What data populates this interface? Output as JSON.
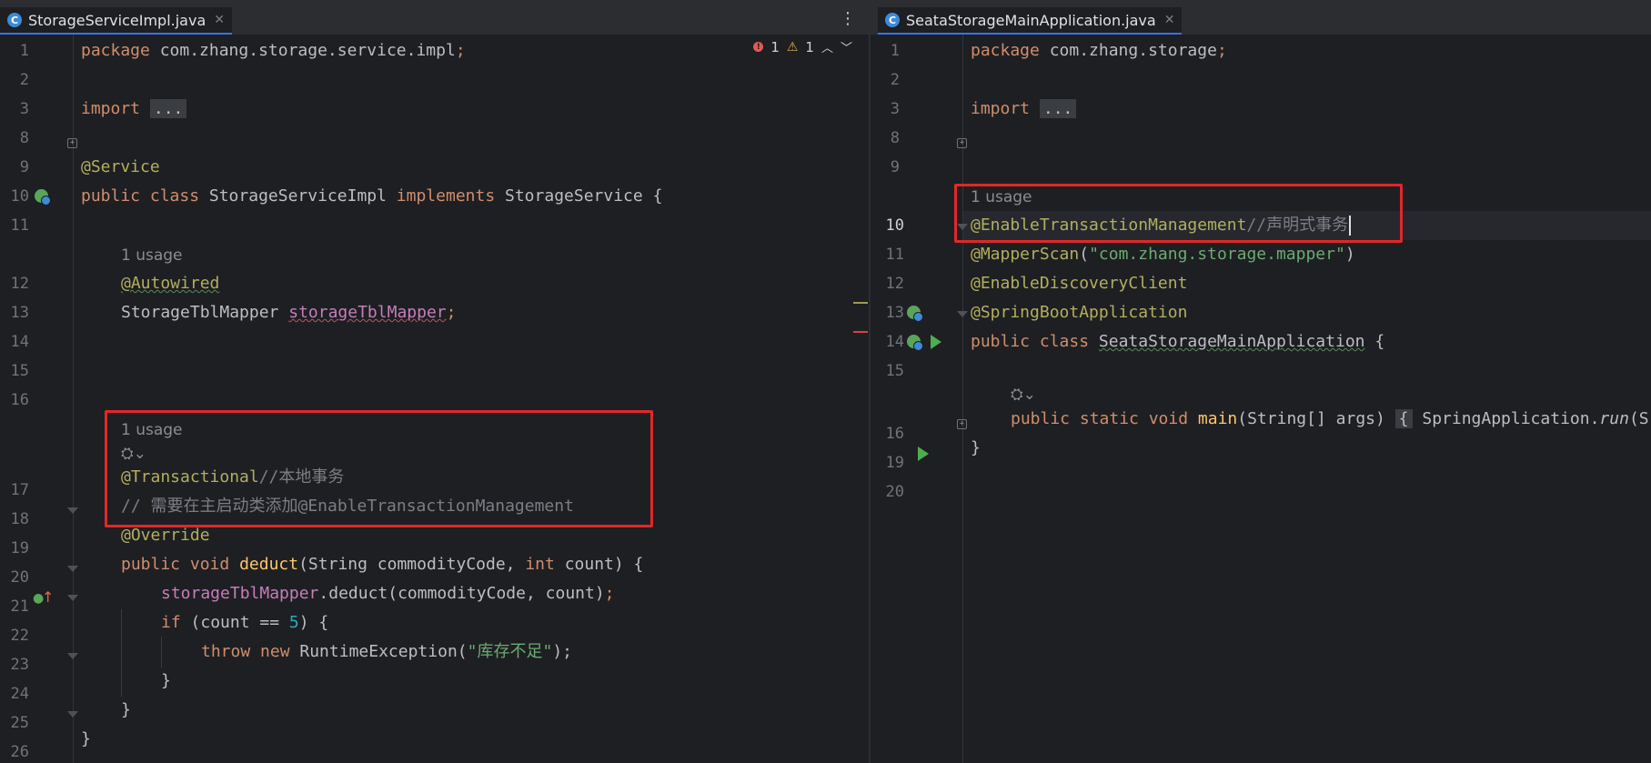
{
  "left_tab": {
    "title": "StorageServiceImpl.java",
    "icon": "C"
  },
  "right_tab": {
    "title": "SeataStorageMainApplication.java",
    "icon": "C"
  },
  "inspections": {
    "errors": "1",
    "warnings": "1"
  },
  "left": {
    "line_numbers": [
      "1",
      "2",
      "3",
      "8",
      "9",
      "10",
      "11",
      "12",
      "13",
      "14",
      "15",
      "16",
      "17",
      "18",
      "19",
      "20",
      "21",
      "22",
      "23",
      "24",
      "25",
      "26"
    ],
    "usage_label": "1 usage",
    "usage_label_2": "1 usage",
    "t": {
      "package_kw": "package",
      "package_name": " com.zhang.storage.service.impl",
      "semi": ";",
      "import_kw": "import",
      "folded": "...",
      "service_ann": "@Service",
      "public_class": "public class",
      "class_name": " StorageServiceImpl ",
      "implements_kw": "implements",
      "iface": " StorageService {",
      "autowired": "@Autowired",
      "mapper_type": "StorageTblMapper ",
      "mapper_field": "storageTblMapper",
      "transactional": "@Transactional",
      "local_tx_comment": "//本地事务",
      "main_comment": "// 需要在主启动类添加@EnableTransactionManagement",
      "override": "@Override",
      "public_void": "public void",
      "deduct": "deduct",
      "params_a": "(String commodityCode, ",
      "int_kw": "int",
      "params_b": " count) {",
      "call_field": "storageTblMapper",
      "call_rest": ".deduct(commodityCode, count)",
      "if_kw": "if",
      "cond_a": " (count == ",
      "five": "5",
      "cond_b": ") {",
      "throw_kw": "throw new",
      "exc": " RuntimeException(",
      "exc_str": "\"库存不足\"",
      "exc_end": ");",
      "brace_close": "}"
    }
  },
  "right": {
    "line_numbers": [
      "1",
      "2",
      "3",
      "8",
      "9",
      "10",
      "11",
      "12",
      "13",
      "14",
      "15",
      "16",
      "19",
      "20"
    ],
    "usage_label": "1 usage",
    "t": {
      "package_kw": "package",
      "package_name": " com.zhang.storage",
      "semi": ";",
      "import_kw": "import",
      "folded": "...",
      "enable_tx": "@EnableTransactionManagement",
      "decl_tx_comment": "//声明式事务",
      "mapper_scan": "@MapperScan",
      "scan_str": "\"com.zhang.storage.mapper\"",
      "paren_open": "(",
      "paren_close": ")",
      "discovery": "@EnableDiscoveryClient",
      "boot_app": "@SpringBootApplication",
      "public_class": "public class",
      "class_name": "SeataStorageMainApplication",
      "class_brace": " {",
      "psv": "public static void",
      "main_fn": "main",
      "main_params": "(String[] args) ",
      "fold_brace": "{",
      "spring_call": " SpringApplication.",
      "run_fn": "run",
      "run_tail": "(S",
      "brace_close": "}"
    }
  }
}
